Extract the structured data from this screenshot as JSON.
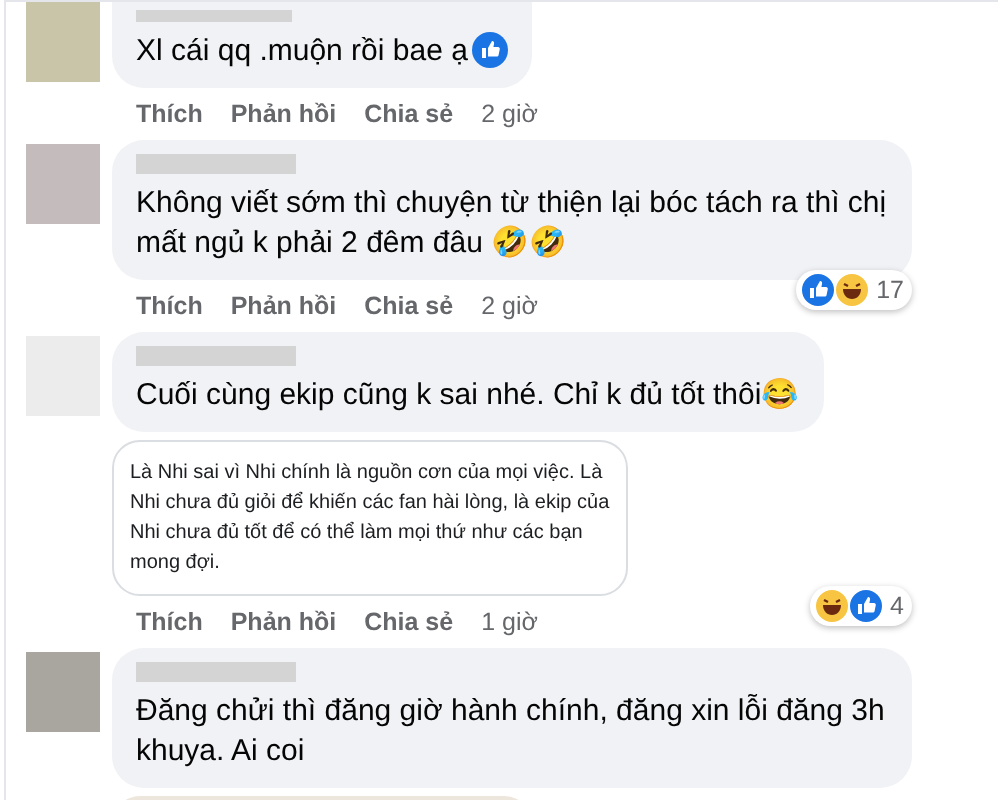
{
  "comments": [
    {
      "kind": "text",
      "text": "Xl cái qq .muộn rồi bae ạ",
      "inline_like": true,
      "actions": [
        "Thích",
        "Phản hồi",
        "Chia sẻ"
      ],
      "time": "2 giờ",
      "cut_top": true
    },
    {
      "kind": "text",
      "text": "Không viết sớm thì chuyện từ thiện lại bóc tách ra thì chị mất ngủ k phải 2 đêm đâu 🤣🤣",
      "reactions": {
        "icons": [
          {
            "kind": "like"
          },
          {
            "kind": "haha"
          }
        ],
        "count": "17"
      },
      "actions": [
        "Thích",
        "Phản hồi",
        "Chia sẻ"
      ],
      "time": "2 giờ"
    },
    {
      "kind": "text",
      "text": "Cuối cùng ekip cũng k sai nhé. Chỉ k đủ tốt thôi😂",
      "reactions": {
        "icons": [
          {
            "kind": "haha"
          },
          {
            "kind": "like"
          }
        ],
        "count": "4"
      },
      "attachment": "Là Nhi sai vì Nhi chính là nguồn cơn của mọi việc. Là Nhi chưa đủ giỏi để khiến các fan hài lòng, là ekip của Nhi chưa đủ tốt để có thể làm mọi thứ như các bạn mong đợi.",
      "actions": [
        "Thích",
        "Phản hồi",
        "Chia sẻ"
      ],
      "time": "1 giờ"
    },
    {
      "kind": "text",
      "text": "Đăng chửi thì đăng giờ hành chính, đăng xin lỗi đăng 3h khuya. Ai coi",
      "photo": true
    }
  ]
}
